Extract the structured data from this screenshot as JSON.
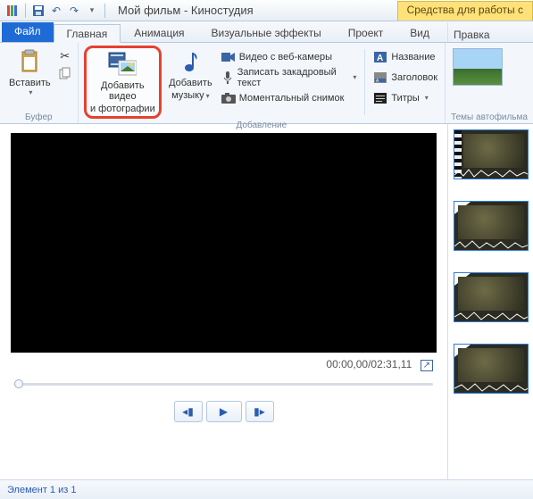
{
  "title": "Мой фильм - Киностудия",
  "context_tab": "Средства для работы с",
  "tabs": {
    "file": "Файл",
    "home": "Главная",
    "animation": "Анимация",
    "vfx": "Визуальные эффекты",
    "project": "Проект",
    "view": "Вид",
    "edit": "Правка"
  },
  "ribbon": {
    "buffer": {
      "label": "Буфер",
      "paste": "Вставить"
    },
    "add": {
      "label": "Добавление",
      "video_photo_l1": "Добавить видео",
      "video_photo_l2": "и фотографии",
      "music_l1": "Добавить",
      "music_l2": "музыку",
      "webcam": "Видео с веб-камеры",
      "narration": "Записать закадровый текст",
      "snapshot": "Моментальный снимок",
      "title": "Название",
      "caption": "Заголовок",
      "credits": "Титры"
    },
    "themes": {
      "label": "Темы автофильма"
    }
  },
  "player": {
    "time": "00:00,00/02:31,11"
  },
  "status": "Элемент 1 из 1"
}
